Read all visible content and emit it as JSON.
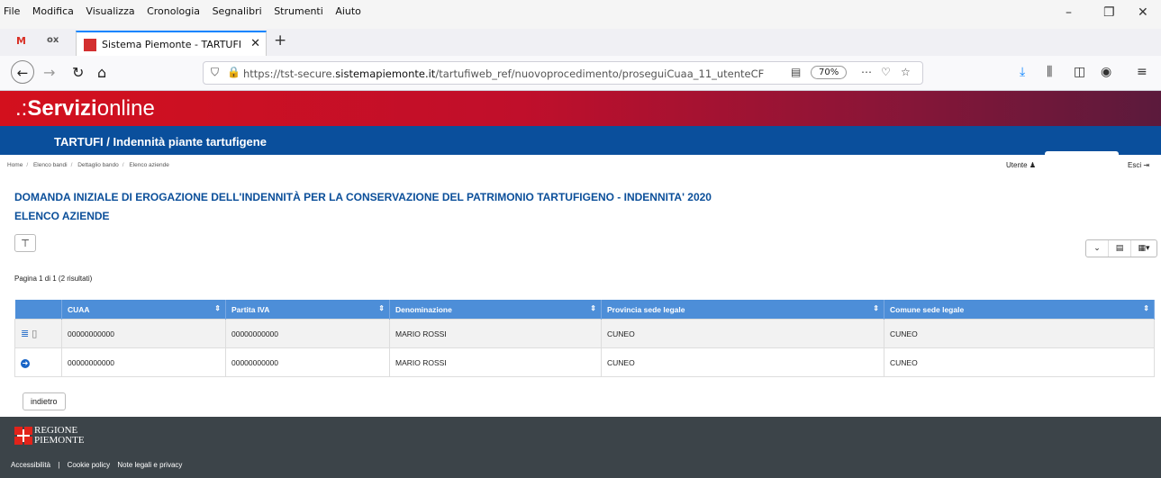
{
  "browser": {
    "menu": [
      "File",
      "Modifica",
      "Visualizza",
      "Cronologia",
      "Segnalibri",
      "Strumenti",
      "Aiuto"
    ],
    "tab_title": "Sistema Piemonte - TARTUFI",
    "url_prefix": "https://tst-secure.",
    "url_domain": "sistemapiemonte.it",
    "url_path": "/tartufiweb_ref/nuovoprocedimento/proseguiCuaa_11_utenteCF",
    "zoom": "70%",
    "pinned": [
      "M",
      "ox"
    ],
    "window_controls": [
      "–",
      "❐",
      "✕"
    ]
  },
  "header": {
    "logo_bold": "Servizi",
    "logo_rest": "online",
    "service_title": "TARTUFI / Indennità piante tartufigene"
  },
  "breadcrumb": [
    "Home",
    "Elenco bandi",
    "Dettaglio bando",
    "Elenco aziende"
  ],
  "user": {
    "label": "Utente",
    "logout": "Esci"
  },
  "page": {
    "title": "DOMANDA INIZIALE DI EROGAZIONE DELL'INDENNITÀ PER LA CONSERVAZIONE DEL PATRIMONIO TARTUFIGENO - INDENNITA' 2020",
    "subtitle": "ELENCO AZIENDE",
    "pagination": "Pagina 1 di 1 (2 risultati)",
    "back_button": "indietro"
  },
  "table": {
    "columns": [
      "CUAA",
      "Partita IVA",
      "Denominazione",
      "Provincia sede legale",
      "Comune sede legale"
    ],
    "rows": [
      {
        "cuaa": "00000000000",
        "piva": "00000000000",
        "denominazione": "MARIO ROSSI",
        "provincia": "CUNEO",
        "comune": "CUNEO"
      },
      {
        "cuaa": "00000000000",
        "piva": "00000000000",
        "denominazione": "MARIO ROSSI",
        "provincia": "CUNEO",
        "comune": "CUNEO"
      }
    ]
  },
  "footer": {
    "region_line1": "REGIONE",
    "region_line2": "PIEMONTE",
    "links": [
      "Accessibilità",
      "|",
      "Cookie policy",
      "Note legali e privacy"
    ]
  },
  "colors": {
    "header_red": "#d3101d",
    "header_blue": "#0a4f9c",
    "table_header": "#4d8ed8",
    "title_blue": "#0b4f9a",
    "footer": "#3c4449"
  }
}
